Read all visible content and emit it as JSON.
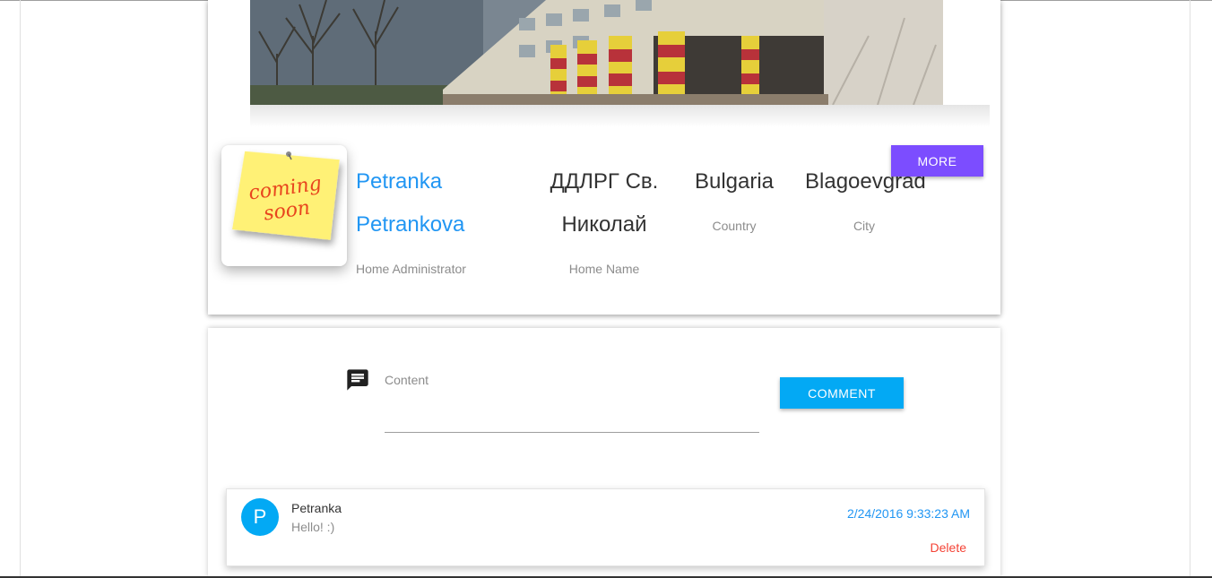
{
  "profile": {
    "first_name": "Petranka",
    "last_name": "Petrankova",
    "admin_caption": "Home Administrator",
    "home_name_line1": "ДДЛРГ Св.",
    "home_name_line2": "Николай",
    "home_name_caption": "Home Name",
    "country": "Bulgaria",
    "country_caption": "Country",
    "city": "Blagoevgrad",
    "city_caption": "City",
    "avatar_note_line1": "coming",
    "avatar_note_line2": "soon",
    "more_label": "MORE"
  },
  "comment_form": {
    "content_label": "Content",
    "content_value": "",
    "submit_label": "COMMENT",
    "icon": "chat-icon"
  },
  "comments": [
    {
      "initial": "P",
      "author": "Petranka",
      "text": "Hello! :)",
      "date": "2/24/2016 9:33:23 AM",
      "delete_label": "Delete"
    }
  ],
  "colors": {
    "accent_blue": "#2196f3",
    "more_button": "#7c4dff",
    "comment_button": "#03a9f4",
    "delete": "#f44336",
    "sticky_note": "#fff176"
  }
}
